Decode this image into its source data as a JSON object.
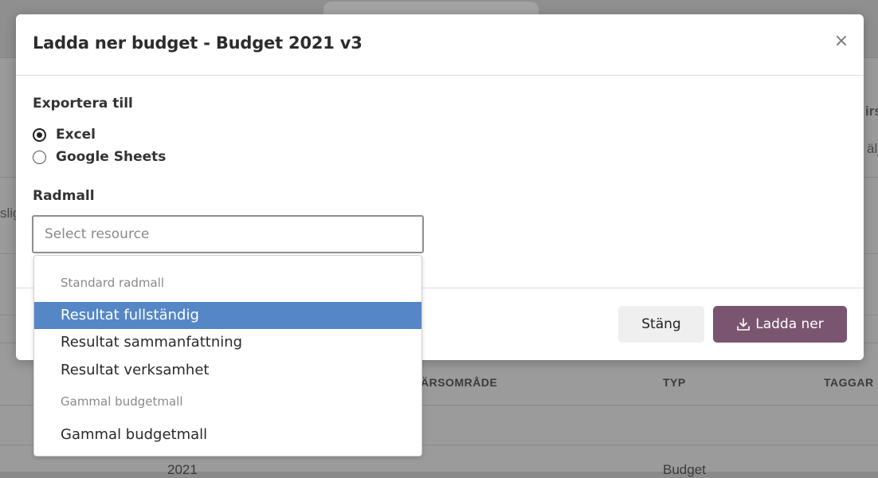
{
  "modal": {
    "title": "Ladda ner budget - Budget 2021 v3",
    "close_glyph": "×",
    "export": {
      "label": "Exportera till",
      "options": [
        {
          "label": "Excel",
          "checked": true
        },
        {
          "label": "Google Sheets",
          "checked": false
        }
      ]
    },
    "row_template": {
      "label": "Radmall",
      "placeholder": "Select resource",
      "value": ""
    },
    "buttons": {
      "close_label": "Stäng",
      "download_label": "Ladda ner"
    }
  },
  "dropdown": {
    "groups": [
      {
        "header": "Standard radmall",
        "options": [
          {
            "label": "Resultat fullständig",
            "highlighted": true
          },
          {
            "label": "Resultat sammanfattning",
            "highlighted": false
          },
          {
            "label": "Resultat verksamhet",
            "highlighted": false
          }
        ]
      },
      {
        "header": "Gammal budgetmall",
        "options": [
          {
            "label": "Gammal budgetmall",
            "highlighted": false
          }
        ]
      }
    ]
  },
  "background": {
    "fragments": {
      "left_text": "slig",
      "right_top": "irs",
      "right_mid": "älj"
    },
    "table": {
      "columns": [
        "ÄRSOMRÅDE",
        "TYP",
        "TAGGAR"
      ],
      "row": {
        "year": "2021",
        "type": "Budget"
      }
    }
  },
  "colors": {
    "primary_button": "#7a5570",
    "highlight": "#5586c6"
  },
  "icons": {
    "close": "close-icon",
    "download": "download-icon"
  }
}
